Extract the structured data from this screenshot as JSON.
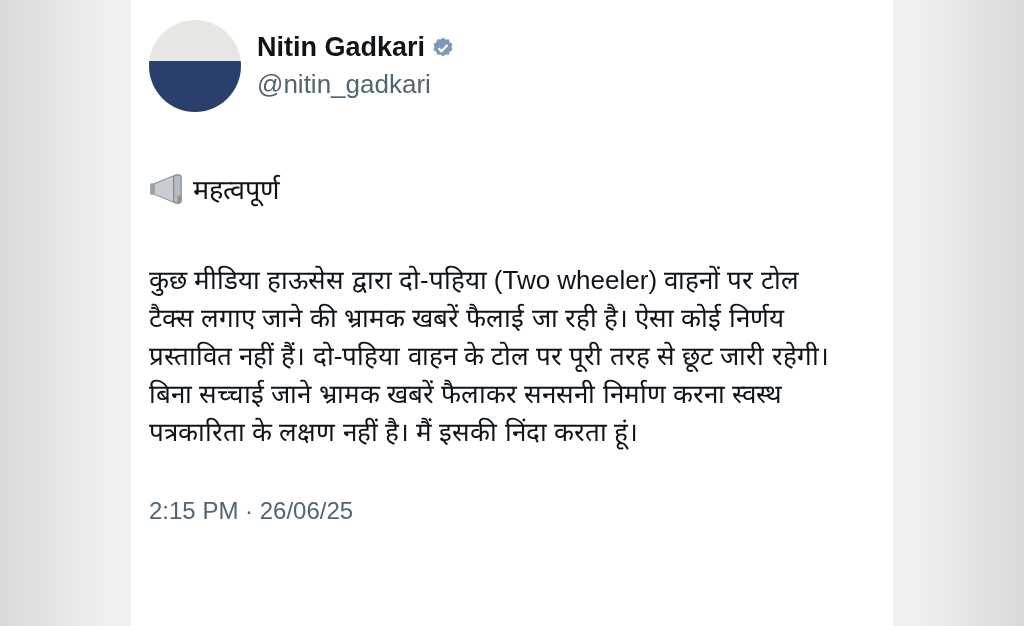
{
  "author": {
    "name": "Nitin Gadkari",
    "handle": "@nitin_gadkari",
    "verified": true
  },
  "post": {
    "heading": "महत्वपूर्ण",
    "body": "कुछ मीडिया हाऊसेस  द्वारा दो-पहिया (Two wheeler) वाहनों पर टोल टैक्स लगाए जाने की भ्रामक खबरें फैलाई जा रही है। ऐसा कोई निर्णय प्रस्तावित नहीं हैं। दो-पहिया वाहन के टोल पर पूरी तरह से छूट जारी रहेगी। बिना सच्चाई जाने भ्रामक खबरें फैलाकर सनसनी निर्माण करना स्वस्थ पत्रकारिता के लक्षण नहीं है। मैं इसकी निंदा करता हूं।",
    "timestamp": "2:15 PM · 26/06/25"
  }
}
